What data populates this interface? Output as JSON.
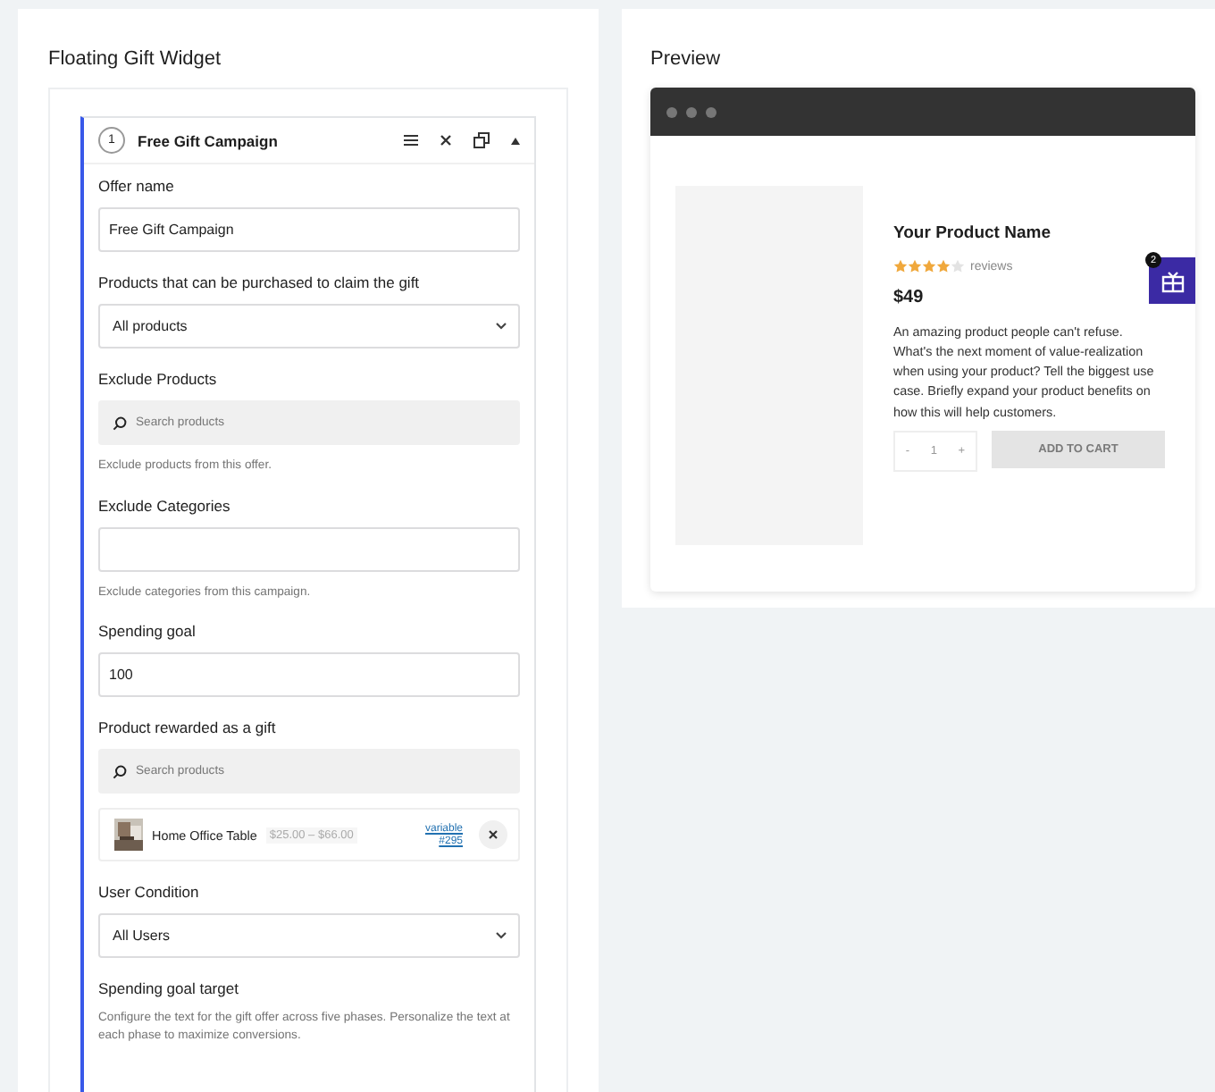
{
  "editor": {
    "title": "Floating Gift Widget",
    "campaign": {
      "number": "1",
      "title": "Free Gift Campaign",
      "expanded": true
    },
    "fields": [
      {
        "kind": "text",
        "label": "Offer name",
        "value": "Free Gift Campaign"
      },
      {
        "kind": "select",
        "label": "Products that can be purchased to claim the gift",
        "value": "All products"
      },
      {
        "kind": "search",
        "label": "Exclude Products",
        "placeholder": "Search products",
        "help": "Exclude products from this offer."
      },
      {
        "kind": "text",
        "label": "Exclude Categories",
        "help": "Exclude categories from this campaign."
      },
      {
        "kind": "text",
        "label": "Spending goal",
        "value": "100"
      },
      {
        "kind": "search",
        "label": "Product rewarded as a gift",
        "placeholder": "Search products",
        "product": {
          "name": "Home Office Table",
          "price": "$25.00 – $66.00",
          "type": "variable",
          "id": "#295"
        }
      },
      {
        "kind": "select",
        "label": "User Condition",
        "value": "All Users"
      },
      {
        "kind": "heading",
        "label": "Spending goal target",
        "help": "Configure the text for the gift offer across five phases. Personalize the text at each phase to maximize conversions."
      }
    ]
  },
  "preview": {
    "title": "Preview",
    "product": {
      "name": "Your Product Name",
      "stars": 4,
      "reviews": "reviews",
      "price": "$49",
      "description": "An amazing product people can't refuse. What's the next moment of value-realization when using your product? Tell the biggest use case. Briefly expand your product benefits on how this will help customers.",
      "qty_minus": "-",
      "qty": "1",
      "qty_plus": "+",
      "add_to_cart": "ADD TO CART"
    },
    "gift_badge": "2"
  }
}
